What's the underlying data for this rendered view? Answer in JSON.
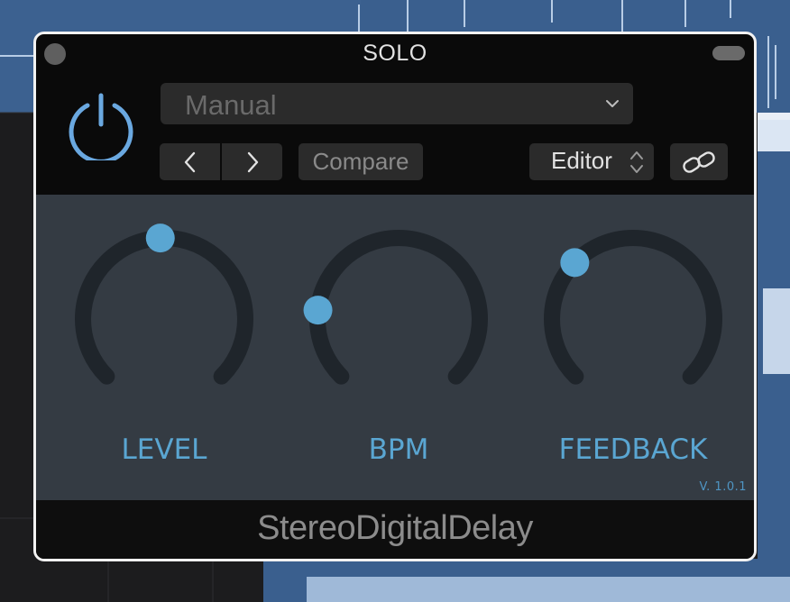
{
  "window": {
    "title": "SOLO"
  },
  "header": {
    "preset": {
      "value": "Manual"
    },
    "compare_label": "Compare",
    "view_select": {
      "value": "Editor"
    }
  },
  "knobs": [
    {
      "label": "LEVEL",
      "value": 0.49
    },
    {
      "label": "BPM",
      "value": 0.19
    },
    {
      "label": "FEEDBACK",
      "value": 0.33
    }
  ],
  "version": "V. 1.0.1",
  "footer": {
    "plugin_name": "StereoDigitalDelay"
  },
  "colors": {
    "accent": "#5aa6d2",
    "power_icon": "#6aa8e0",
    "knob_track": "#1f252b",
    "panel": "#343b43"
  },
  "icons": {
    "power": "power-icon",
    "chevron": "chevron-down-icon",
    "prev": "chevron-left-icon",
    "next": "chevron-right-icon",
    "updown": "updown-arrows-icon",
    "link": "link-icon"
  }
}
